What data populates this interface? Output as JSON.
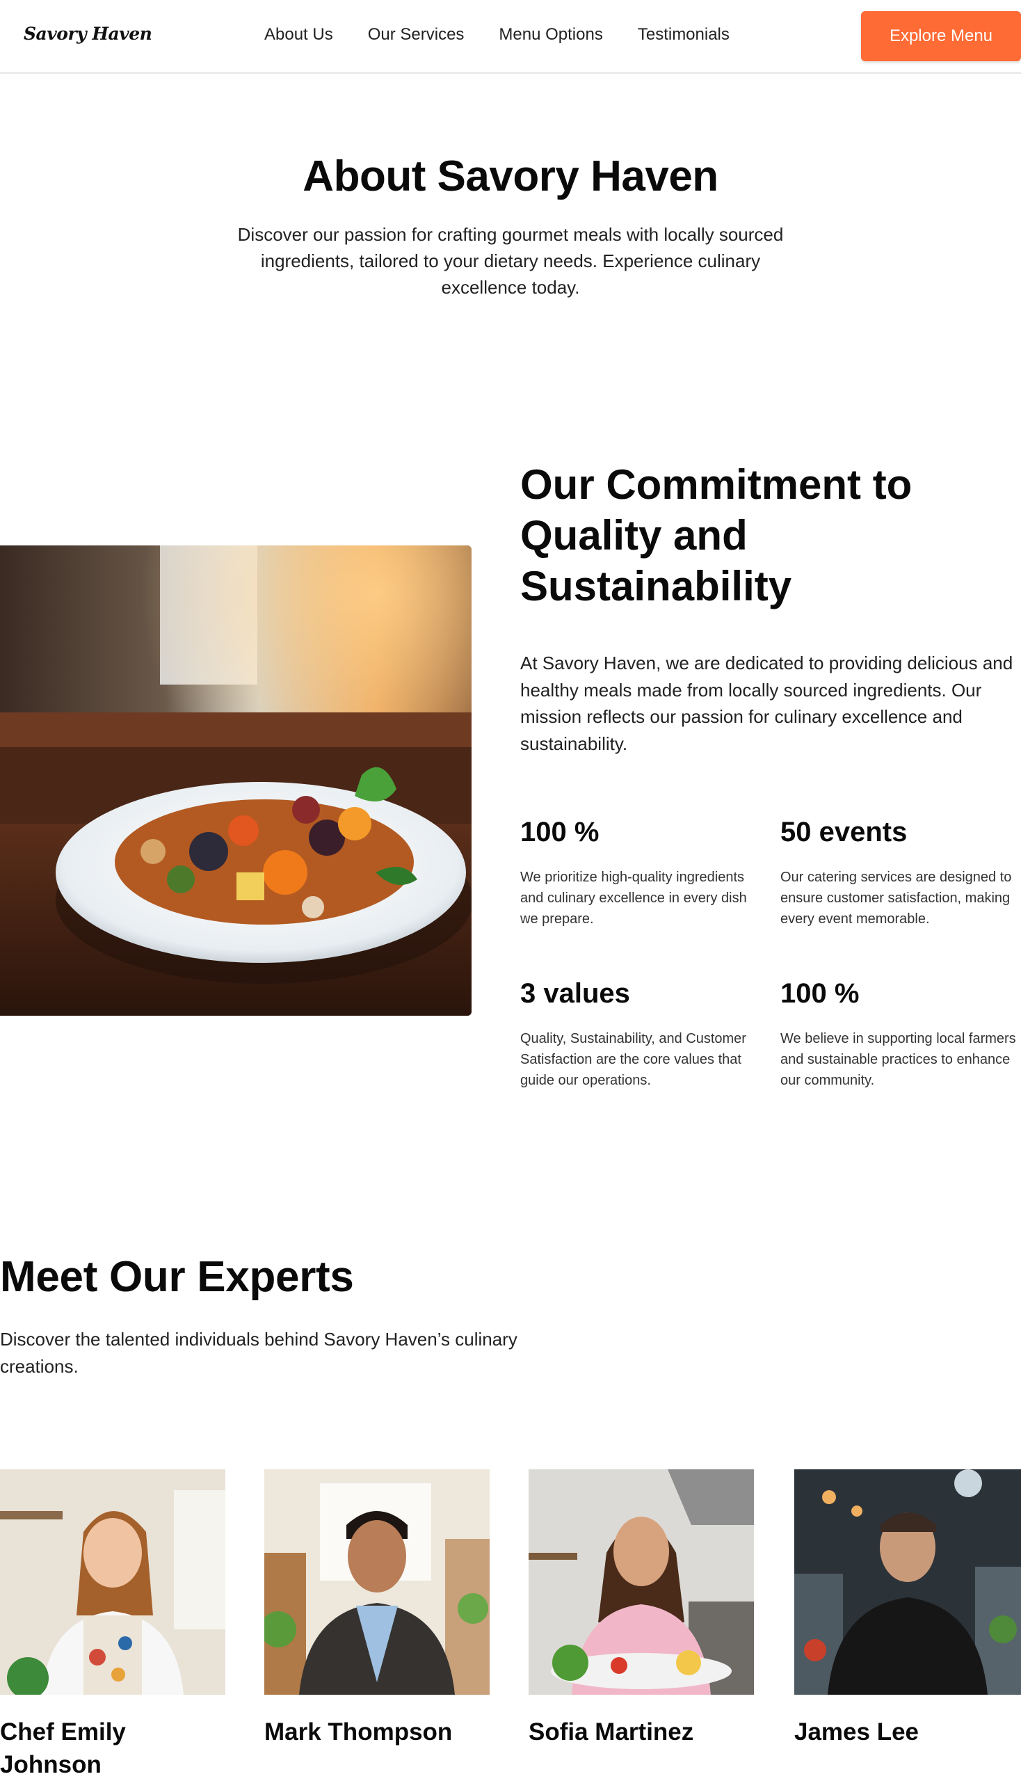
{
  "nav": {
    "logo": "Savory Haven",
    "links": [
      "About Us",
      "Our Services",
      "Menu Options",
      "Testimonials"
    ],
    "cta_label": "Explore Menu"
  },
  "hero": {
    "title": "About Savory Haven",
    "subtitle": "Discover our passion for crafting gourmet meals with locally sourced ingredients, tailored to your dietary needs. Experience culinary excellence today."
  },
  "commitment": {
    "title": "Our Commitment to Quality and Sustainability",
    "text": "At Savory Haven, we are dedicated to providing delicious and healthy meals made from locally sourced ingredients. Our mission reflects our passion for culinary excellence and sustainability.",
    "stats": [
      {
        "value": "100 %",
        "desc": "We prioritize high-quality ingredients and culinary excellence in every dish we prepare."
      },
      {
        "value": "50 events",
        "desc": "Our catering services are designed to ensure customer satisfaction, making every event memorable."
      },
      {
        "value": "3 values",
        "desc": "Quality, Sustainability, and Customer Satisfaction are the core values that guide our operations."
      },
      {
        "value": "100 %",
        "desc": "We believe in supporting local farmers and sustainable practices to enhance our community."
      }
    ]
  },
  "experts": {
    "title": "Meet Our Experts",
    "subtitle": "Discover the talented individuals behind Savory Haven’s culinary creations.",
    "members": [
      {
        "name": "Chef Emily Johnson"
      },
      {
        "name": "Mark Thompson"
      },
      {
        "name": "Sofia Martinez"
      },
      {
        "name": "James Lee"
      }
    ]
  },
  "colors": {
    "accent": "#ff6b35",
    "text": "#111111",
    "divider": "#e6e6e6"
  }
}
